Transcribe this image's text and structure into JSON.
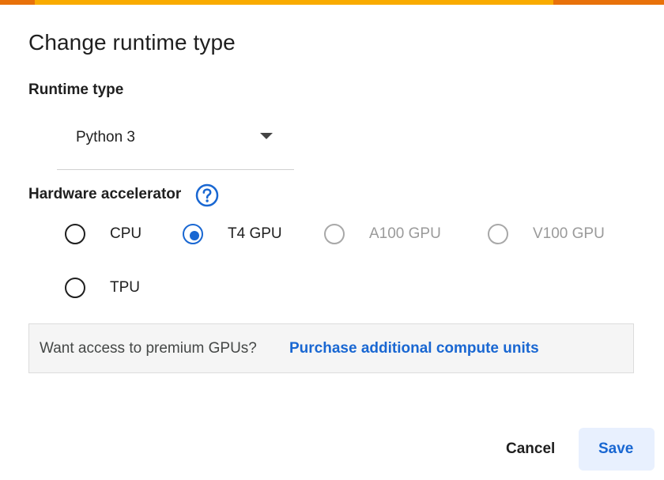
{
  "dialog": {
    "title": "Change runtime type",
    "accent_colors": [
      "#e8710a",
      "#f9ab00"
    ]
  },
  "runtime": {
    "label": "Runtime type",
    "selected": "Python 3"
  },
  "hardware": {
    "label": "Hardware accelerator",
    "help_icon": "question-circle-icon",
    "options": [
      {
        "label": "CPU",
        "selected": false,
        "disabled": false
      },
      {
        "label": "T4 GPU",
        "selected": true,
        "disabled": false
      },
      {
        "label": "A100 GPU",
        "selected": false,
        "disabled": true
      },
      {
        "label": "V100 GPU",
        "selected": false,
        "disabled": true
      },
      {
        "label": "TPU",
        "selected": false,
        "disabled": false
      }
    ]
  },
  "promo": {
    "question": "Want access to premium GPUs?",
    "link": "Purchase additional compute units"
  },
  "buttons": {
    "cancel": "Cancel",
    "save": "Save"
  },
  "colors": {
    "primary": "#1967d2",
    "save_bg": "#e8f0fe",
    "disabled": "#a8a8a8"
  }
}
